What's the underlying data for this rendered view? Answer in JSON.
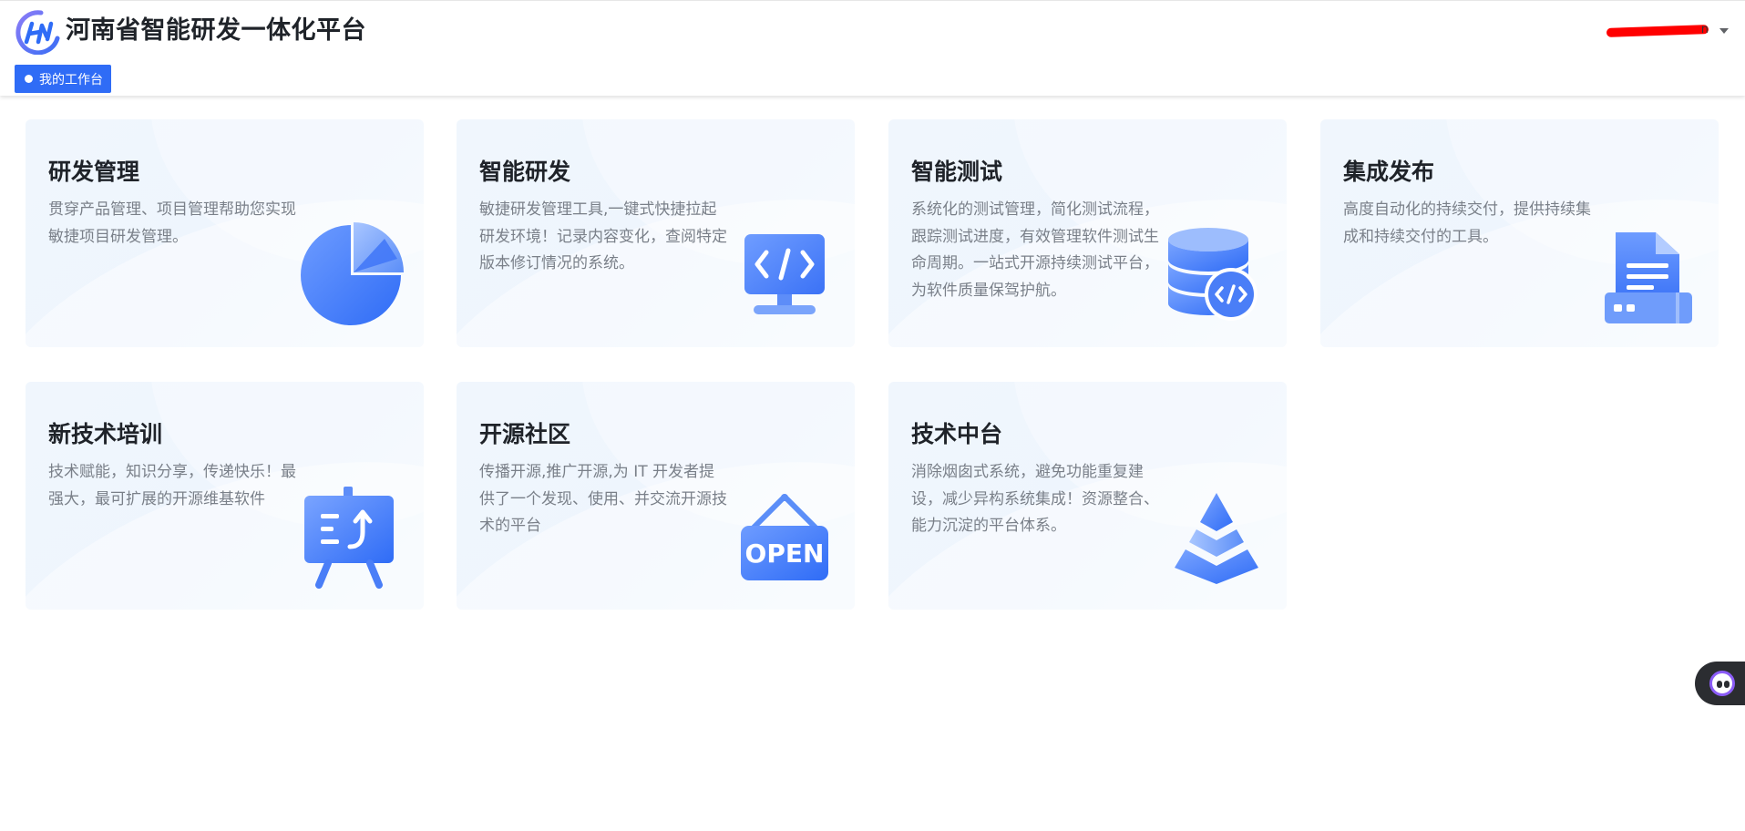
{
  "header": {
    "app_title": "河南省智能研发一体化平台",
    "user_name_visible": "n",
    "tab_label": "我的工作台"
  },
  "colors": {
    "accent": "#2f6cf6",
    "card_bg": "#eef5fd",
    "title": "#1f2329",
    "desc": "#7a8089"
  },
  "cards": [
    {
      "title": "研发管理",
      "desc": "贯穿产品管理、项目管理帮助您实现敏捷项目研发管理。",
      "icon": "pie-chart-icon"
    },
    {
      "title": "智能研发",
      "desc": "敏捷研发管理工具,一键式快捷拉起研发环境！记录内容变化，查阅特定版本修订情况的系统。",
      "icon": "code-monitor-icon"
    },
    {
      "title": "智能测试",
      "desc": "系统化的测试管理，简化测试流程，跟踪测试进度，有效管理软件测试生命周期。一站式开源持续测试平台，为软件质量保驾护航。",
      "icon": "database-code-icon"
    },
    {
      "title": "集成发布",
      "desc": "高度自动化的持续交付，提供持续集成和持续交付的工具。",
      "icon": "file-server-icon"
    },
    {
      "title": "新技术培训",
      "desc": "技术赋能，知识分享，传递快乐！最强大，最可扩展的开源维基软件",
      "icon": "training-board-icon"
    },
    {
      "title": "开源社区",
      "desc": "传播开源,推广开源,为 IT 开发者提供了一个发现、使用、并交流开源技术的平台",
      "icon": "open-sign-icon"
    },
    {
      "title": "技术中台",
      "desc": "消除烟囱式系统，避免功能重复建设，减少异构系统集成！资源整合、能力沉淀的平台体系。",
      "icon": "pyramid-icon"
    }
  ],
  "open_sign_text": "OPEN"
}
